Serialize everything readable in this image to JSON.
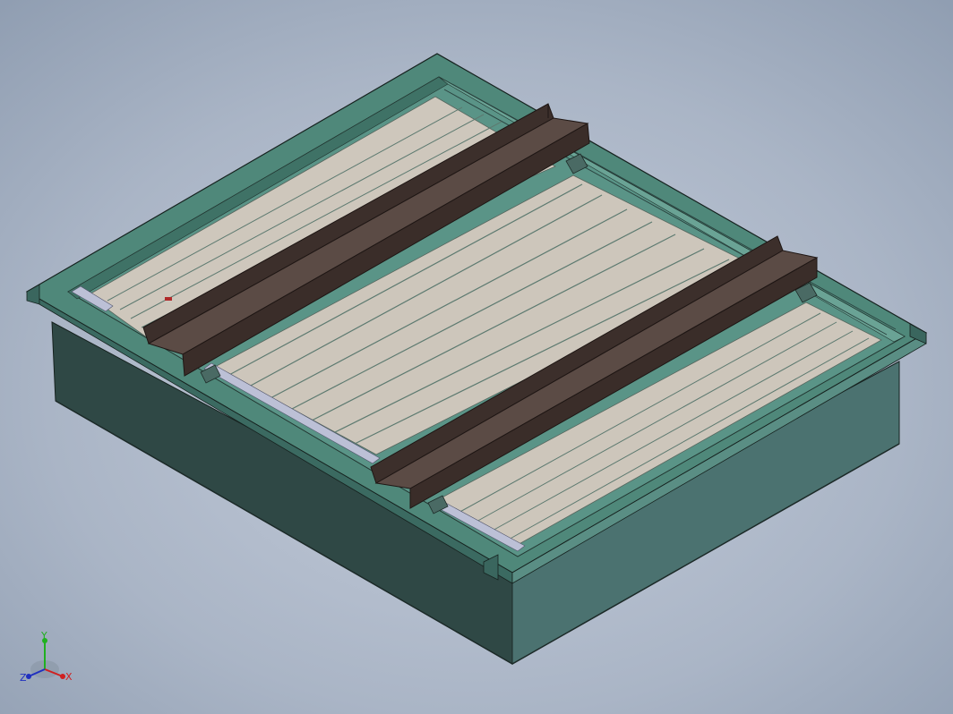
{
  "viewport": {
    "model": "isometric-frame-assembly",
    "background": {
      "top": "#9aa8ba",
      "center": "#c2cad8",
      "bottom": "#d4d9e2"
    }
  },
  "colors": {
    "frame_top": "#4c8578",
    "frame_side_dark": "#2e4744",
    "frame_side_light": "#4e7571",
    "frame_inner": "#5c968a",
    "panel": "#cfc7bb",
    "panel_edge": "#5a6a62",
    "channel_top": "#5a4a44",
    "channel_side": "#3d302c",
    "channel_edge": "#231a17",
    "rail_strip": "#bcc0d6"
  },
  "triad": {
    "x_label": "X",
    "y_label": "Y",
    "z_label": "Z",
    "x_color": "#d02020",
    "y_color": "#20b020",
    "z_color": "#2030c0"
  }
}
